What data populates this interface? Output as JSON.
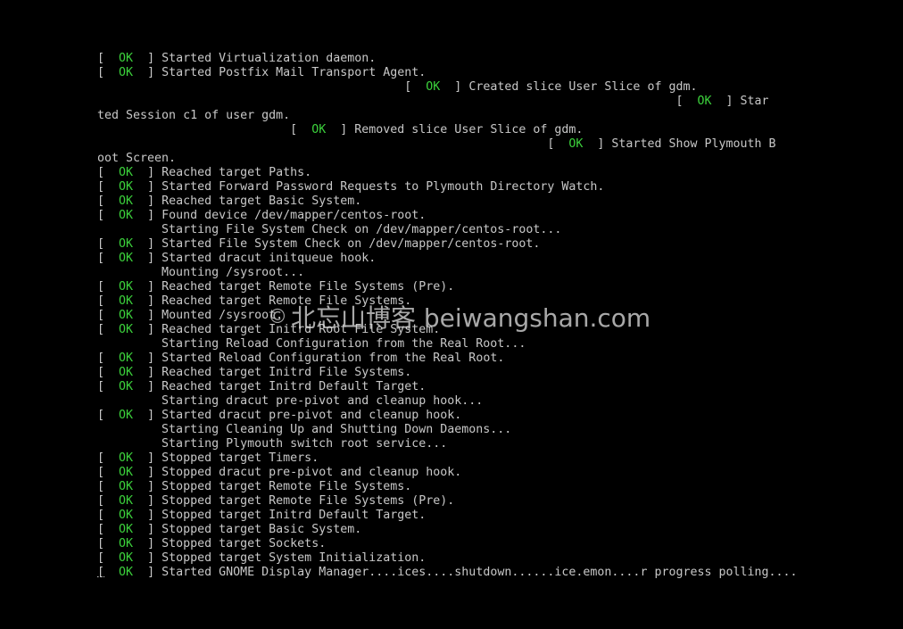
{
  "colors": {
    "background": "#000000",
    "text": "#c8c8c8",
    "ok": "#3cd23c"
  },
  "console": {
    "lines": [
      {
        "pad": "",
        "status": "OK",
        "text": "Started Virtualization daemon."
      },
      {
        "pad": "",
        "status": "OK",
        "text": "Started Postfix Mail Transport Agent."
      },
      {
        "pad": "                                           ",
        "status": "OK",
        "text": "Created slice User Slice of gdm."
      },
      {
        "pad": "                                                                                 ",
        "status": "OK",
        "text": "Star"
      },
      {
        "pad": "",
        "status": "",
        "text": "ted Session c1 of user gdm."
      },
      {
        "pad": "                           ",
        "status": "OK",
        "text": "Removed slice User Slice of gdm."
      },
      {
        "pad": "                                                               ",
        "status": "OK",
        "text": "Started Show Plymouth B"
      },
      {
        "pad": "",
        "status": "",
        "text": "oot Screen."
      },
      {
        "pad": "",
        "status": "OK",
        "text": "Reached target Paths."
      },
      {
        "pad": "",
        "status": "OK",
        "text": "Started Forward Password Requests to Plymouth Directory Watch."
      },
      {
        "pad": "",
        "status": "OK",
        "text": "Reached target Basic System."
      },
      {
        "pad": "",
        "status": "OK",
        "text": "Found device /dev/mapper/centos-root."
      },
      {
        "pad": "",
        "status": "",
        "text": "         Starting File System Check on /dev/mapper/centos-root..."
      },
      {
        "pad": "",
        "status": "OK",
        "text": "Started File System Check on /dev/mapper/centos-root."
      },
      {
        "pad": "",
        "status": "OK",
        "text": "Started dracut initqueue hook."
      },
      {
        "pad": "",
        "status": "",
        "text": "         Mounting /sysroot..."
      },
      {
        "pad": "",
        "status": "OK",
        "text": "Reached target Remote File Systems (Pre)."
      },
      {
        "pad": "",
        "status": "OK",
        "text": "Reached target Remote File Systems."
      },
      {
        "pad": "",
        "status": "OK",
        "text": "Mounted /sysroot."
      },
      {
        "pad": "",
        "status": "OK",
        "text": "Reached target Initrd Root File System."
      },
      {
        "pad": "",
        "status": "",
        "text": "         Starting Reload Configuration from the Real Root..."
      },
      {
        "pad": "",
        "status": "OK",
        "text": "Started Reload Configuration from the Real Root."
      },
      {
        "pad": "",
        "status": "OK",
        "text": "Reached target Initrd File Systems."
      },
      {
        "pad": "",
        "status": "OK",
        "text": "Reached target Initrd Default Target."
      },
      {
        "pad": "",
        "status": "",
        "text": "         Starting dracut pre-pivot and cleanup hook..."
      },
      {
        "pad": "",
        "status": "OK",
        "text": "Started dracut pre-pivot and cleanup hook."
      },
      {
        "pad": "",
        "status": "",
        "text": "         Starting Cleaning Up and Shutting Down Daemons..."
      },
      {
        "pad": "",
        "status": "",
        "text": "         Starting Plymouth switch root service..."
      },
      {
        "pad": "",
        "status": "OK",
        "text": "Stopped target Timers."
      },
      {
        "pad": "",
        "status": "OK",
        "text": "Stopped dracut pre-pivot and cleanup hook."
      },
      {
        "pad": "",
        "status": "OK",
        "text": "Stopped target Remote File Systems."
      },
      {
        "pad": "",
        "status": "OK",
        "text": "Stopped target Remote File Systems (Pre)."
      },
      {
        "pad": "",
        "status": "OK",
        "text": "Stopped target Initrd Default Target."
      },
      {
        "pad": "",
        "status": "OK",
        "text": "Stopped target Basic System."
      },
      {
        "pad": "",
        "status": "OK",
        "text": "Stopped target Sockets."
      },
      {
        "pad": "",
        "status": "OK",
        "text": "Stopped target System Initialization."
      },
      {
        "pad": "",
        "status": "OK",
        "text": "Started GNOME Display Manager....ices....shutdown......ice.emon....r progress polling....",
        "cursor": true
      }
    ]
  },
  "watermark": {
    "symbol": "©",
    "text": "北忘山博客 beiwangshan.com"
  }
}
